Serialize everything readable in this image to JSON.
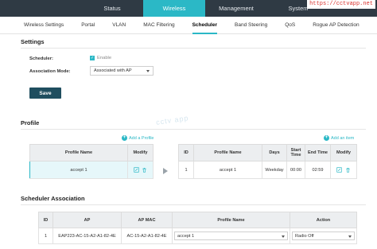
{
  "watermark_url": "https://cctvapp.net",
  "watermark_center": "cctv app",
  "top_nav": [
    "Status",
    "Wireless",
    "Management",
    "System"
  ],
  "sub_tabs": [
    "Wireless Settings",
    "Portal",
    "VLAN",
    "MAC Filtering",
    "Scheduler",
    "Band Steering",
    "QoS",
    "Rogue AP Detection"
  ],
  "settings": {
    "title": "Settings",
    "scheduler_label": "Scheduler:",
    "scheduler_enable_text": "Enable",
    "assoc_mode_label": "Association Mode:",
    "assoc_mode_value": "Associated with AP",
    "save_label": "Save"
  },
  "profile": {
    "title": "Profile",
    "add_profile": "Add a Profile",
    "add_item": "Add an item",
    "left_headers": [
      "Profile Name",
      "Modify"
    ],
    "left_rows": [
      {
        "name": "accept 1"
      }
    ],
    "right_headers": [
      "ID",
      "Profile Name",
      "Days",
      "Start Time",
      "End Time",
      "Modify"
    ],
    "right_rows": [
      {
        "id": "1",
        "name": "accept 1",
        "days": "Weekday",
        "start": "00:00",
        "end": "02:59"
      }
    ]
  },
  "association": {
    "title": "Scheduler Association",
    "headers": [
      "ID",
      "AP",
      "AP MAC",
      "Profile Name",
      "Action"
    ],
    "rows": [
      {
        "id": "1",
        "ap": "EAP223-AC-15-A2-A1-82-4E",
        "mac": "AC-15-A2-A1-82-4E",
        "profile": "accept 1",
        "action": "Radio Off"
      }
    ]
  },
  "colors": {
    "accent": "#2bb8c6",
    "topbar": "#2f3a44",
    "button": "#1f4e5f"
  },
  "icons": [
    "edit-icon",
    "delete-icon",
    "plus-icon",
    "arrow-right-icon"
  ]
}
